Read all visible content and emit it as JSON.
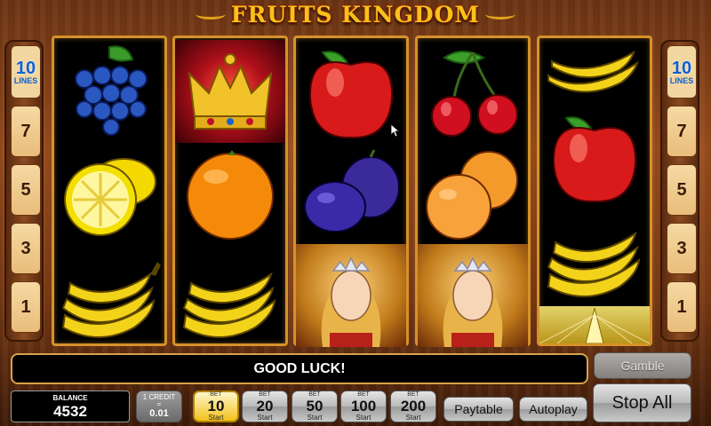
{
  "title": "FRUITS KINGDOM",
  "lines": {
    "count": "10",
    "word": "LINES",
    "numbers": [
      "7",
      "5",
      "3",
      "1"
    ]
  },
  "reels": [
    [
      "grapes",
      "lemon",
      "banana"
    ],
    [
      "crown",
      "orange",
      "banana"
    ],
    [
      "apple",
      "plum",
      "princess"
    ],
    [
      "cherry",
      "apricot",
      "princess"
    ],
    [
      "banana",
      "apple",
      "banana",
      "star"
    ]
  ],
  "message": "GOOD LUCK!",
  "balance": {
    "label": "BALANCE",
    "value": "4532"
  },
  "credit": {
    "line1": "1 CREDIT",
    "line2": "=",
    "value": "0.01"
  },
  "bets": [
    {
      "label": "BET",
      "value": "10",
      "start": "Start",
      "active": true
    },
    {
      "label": "BET",
      "value": "20",
      "start": "Start",
      "active": false
    },
    {
      "label": "BET",
      "value": "50",
      "start": "Start",
      "active": false
    },
    {
      "label": "BET",
      "value": "100",
      "start": "Start",
      "active": false
    },
    {
      "label": "BET",
      "value": "200",
      "start": "Start",
      "active": false
    }
  ],
  "buttons": {
    "paytable": "Paytable",
    "autoplay": "Autoplay",
    "gamble": "Gamble",
    "stop_all": "Stop All"
  },
  "colors": {
    "title": "#f6c21a",
    "reel_border": "#d6912a",
    "active_bet": "#f2c21c"
  }
}
